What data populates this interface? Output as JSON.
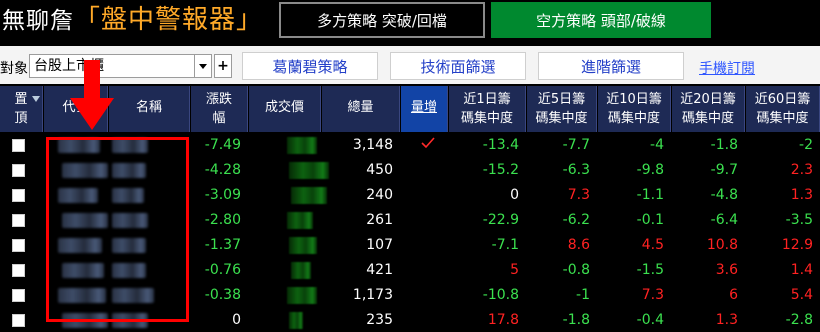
{
  "header": {
    "app_name": "無聊詹",
    "title": "「盤中警報器」",
    "tabs": [
      {
        "label": "多方策略  突破/回檔"
      },
      {
        "label": "空方策略  頭部/破線"
      }
    ]
  },
  "toolbar": {
    "object_label": "對象",
    "market_value": "台股上市櫃",
    "plus_label": "+",
    "buttons": [
      {
        "label": "葛蘭碧策略"
      },
      {
        "label": "技術面篩選"
      },
      {
        "label": "進階篩選"
      }
    ],
    "mobile_link": "手機訂閱"
  },
  "table": {
    "headers": [
      {
        "lines": [
          "置",
          "頂"
        ]
      },
      {
        "lines": [
          "代號"
        ]
      },
      {
        "lines": [
          "名稱"
        ]
      },
      {
        "lines": [
          "漲跌",
          "幅"
        ]
      },
      {
        "lines": [
          "成交價"
        ]
      },
      {
        "lines": [
          "總量"
        ]
      },
      {
        "lines": [
          "量增"
        ]
      },
      {
        "lines": [
          "近1日籌",
          "碼集中度"
        ]
      },
      {
        "lines": [
          "近5日籌",
          "碼集中度"
        ]
      },
      {
        "lines": [
          "近10日籌",
          "碼集中度"
        ]
      },
      {
        "lines": [
          "近20日籌",
          "碼集中度"
        ]
      },
      {
        "lines": [
          "近60日籌",
          "碼集中度"
        ]
      }
    ],
    "rows": [
      {
        "change": "-7.49",
        "change_color": "green",
        "volume": "3,148",
        "volume_up": true,
        "d1": "-13.4",
        "d1c": "green",
        "d5": "-7.7",
        "d5c": "green",
        "d10": "-4",
        "d10c": "green",
        "d20": "-1.8",
        "d20c": "green",
        "d60": "-2",
        "d60c": "green"
      },
      {
        "change": "-4.28",
        "change_color": "green",
        "volume": "450",
        "volume_up": false,
        "d1": "-15.2",
        "d1c": "green",
        "d5": "-6.3",
        "d5c": "green",
        "d10": "-9.8",
        "d10c": "green",
        "d20": "-9.7",
        "d20c": "green",
        "d60": "2.3",
        "d60c": "red"
      },
      {
        "change": "-3.09",
        "change_color": "green",
        "volume": "240",
        "volume_up": false,
        "d1": "0",
        "d1c": "white",
        "d5": "7.3",
        "d5c": "red",
        "d10": "-1.1",
        "d10c": "green",
        "d20": "-4.8",
        "d20c": "green",
        "d60": "1.3",
        "d60c": "red"
      },
      {
        "change": "-2.80",
        "change_color": "green",
        "volume": "261",
        "volume_up": false,
        "d1": "-22.9",
        "d1c": "green",
        "d5": "-6.2",
        "d5c": "green",
        "d10": "-0.1",
        "d10c": "green",
        "d20": "-6.4",
        "d20c": "green",
        "d60": "-3.5",
        "d60c": "green"
      },
      {
        "change": "-1.37",
        "change_color": "green",
        "volume": "107",
        "volume_up": false,
        "d1": "-7.1",
        "d1c": "green",
        "d5": "8.6",
        "d5c": "red",
        "d10": "4.5",
        "d10c": "red",
        "d20": "10.8",
        "d20c": "red",
        "d60": "12.9",
        "d60c": "red"
      },
      {
        "change": "-0.76",
        "change_color": "green",
        "volume": "421",
        "volume_up": false,
        "d1": "5",
        "d1c": "red",
        "d5": "-0.8",
        "d5c": "green",
        "d10": "-1.5",
        "d10c": "green",
        "d20": "3.6",
        "d20c": "red",
        "d60": "1.4",
        "d60c": "red"
      },
      {
        "change": "-0.38",
        "change_color": "green",
        "volume": "1,173",
        "volume_up": false,
        "d1": "-10.8",
        "d1c": "green",
        "d5": "-1",
        "d5c": "green",
        "d10": "7.3",
        "d10c": "red",
        "d20": "6",
        "d20c": "red",
        "d60": "5.4",
        "d60c": "red"
      },
      {
        "change": "0",
        "change_color": "white",
        "volume": "235",
        "volume_up": false,
        "d1": "17.8",
        "d1c": "red",
        "d5": "-1.8",
        "d5c": "green",
        "d10": "-0.4",
        "d10c": "green",
        "d20": "1.3",
        "d20c": "red",
        "d60": "-2.8",
        "d60c": "green"
      }
    ]
  },
  "colors": {
    "green": "#3be04f",
    "red": "#ff2222",
    "white": "#ffffff",
    "header_bg": "#1e2a55",
    "bear_tab": "#00892f",
    "brand_orange": "#ffa928",
    "annotation_red": "#ff0000"
  },
  "icons": [
    "dropdown-arrow-icon",
    "plus-icon",
    "sort-icon",
    "checkmark-icon",
    "down-arrow-annotation-icon"
  ]
}
